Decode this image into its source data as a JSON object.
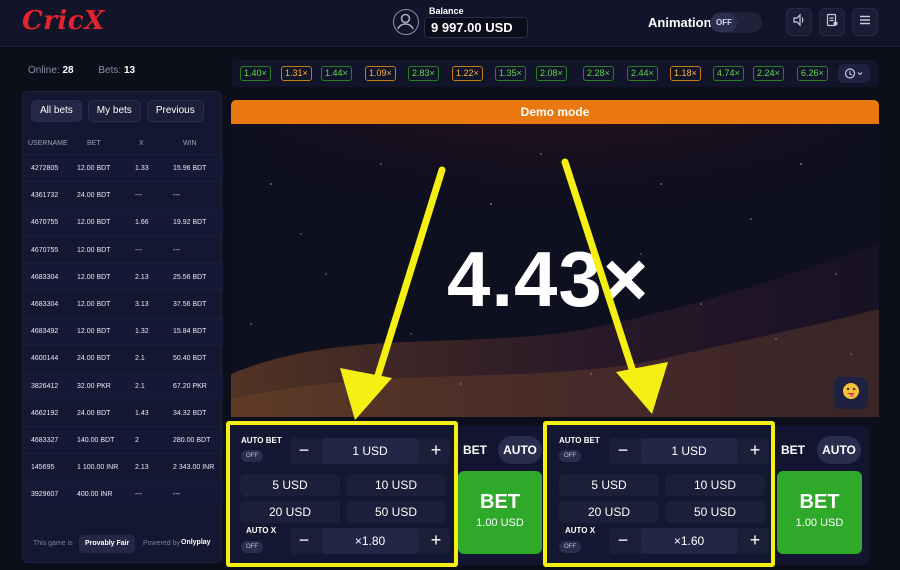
{
  "header": {
    "logo": "CricX",
    "balance_label": "Balance",
    "balance_value": "9 997.00 USD",
    "animation_label": "Animation",
    "animation_toggle": "OFF"
  },
  "sidebar": {
    "online_label": "Online:",
    "online_count": "28",
    "bets_label": "Bets:",
    "bets_count": "13",
    "tabs": [
      {
        "label": "All bets"
      },
      {
        "label": "My bets"
      },
      {
        "label": "Previous"
      }
    ],
    "columns": [
      "USERNAME",
      "BET",
      "X",
      "WIN"
    ],
    "rows": [
      {
        "user": "4272805",
        "bet": "12.00 BDT",
        "x": "1.33",
        "win": "15.96 BDT"
      },
      {
        "user": "4361732",
        "bet": "24.00 BDT",
        "x": "---",
        "win": "---"
      },
      {
        "user": "4670755",
        "bet": "12.00 BDT",
        "x": "1.66",
        "win": "19.92 BDT"
      },
      {
        "user": "4670755",
        "bet": "12.00 BDT",
        "x": "---",
        "win": "---"
      },
      {
        "user": "4683304",
        "bet": "12.00 BDT",
        "x": "2.13",
        "win": "25.56 BDT"
      },
      {
        "user": "4683304",
        "bet": "12.00 BDT",
        "x": "3.13",
        "win": "37.56 BDT"
      },
      {
        "user": "4683492",
        "bet": "12.00 BDT",
        "x": "1.32",
        "win": "15.84 BDT"
      },
      {
        "user": "4600144",
        "bet": "24.00 BDT",
        "x": "2.1",
        "win": "50.40 BDT"
      },
      {
        "user": "3826412",
        "bet": "32.00 PKR",
        "x": "2.1",
        "win": "67.20 PKR"
      },
      {
        "user": "4662192",
        "bet": "24.00 BDT",
        "x": "1.43",
        "win": "34.32 BDT"
      },
      {
        "user": "4683327",
        "bet": "140.00 BDT",
        "x": "2",
        "win": "280.00 BDT"
      },
      {
        "user": "145695",
        "bet": "1 100.00 INR",
        "x": "2.13",
        "win": "2 343.00 INR"
      },
      {
        "user": "3929607",
        "bet": "400.00 INR",
        "x": "---",
        "win": "---"
      }
    ],
    "footer": {
      "prefix": "This game is",
      "badge": "Provably Fair",
      "powered": "Powered by",
      "brand": "Onlyplay"
    }
  },
  "history": [
    {
      "v": "1.40×",
      "c": "green"
    },
    {
      "v": "1.31×",
      "c": "orange"
    },
    {
      "v": "1.44×",
      "c": "green"
    },
    {
      "v": "1.09×",
      "c": "orange"
    },
    {
      "v": "2.83×",
      "c": "green"
    },
    {
      "v": "1.22×",
      "c": "orange"
    },
    {
      "v": "1.35×",
      "c": "green"
    },
    {
      "v": "2.08×",
      "c": "green"
    },
    {
      "v": "2.28×",
      "c": "green"
    },
    {
      "v": "2.44×",
      "c": "green"
    },
    {
      "v": "1.18×",
      "c": "orange"
    },
    {
      "v": "4.74×",
      "c": "green"
    },
    {
      "v": "2.24×",
      "c": "green"
    },
    {
      "v": "6.26×",
      "c": "green"
    }
  ],
  "game": {
    "demo_label": "Demo mode",
    "multiplier": "4.43×"
  },
  "bet_panels": [
    {
      "auto_bet_label": "AUTO BET",
      "auto_bet_toggle": "OFF",
      "amount": "1 USD",
      "quick": [
        "5 USD",
        "10 USD",
        "20 USD",
        "50 USD"
      ],
      "auto_x_label": "AUTO X",
      "auto_x_toggle": "OFF",
      "auto_x_value": "×1.80",
      "mode_bet": "BET",
      "mode_auto": "AUTO",
      "bet_button": "BET",
      "bet_amount": "1.00 USD",
      "minus": "−",
      "plus": "+"
    },
    {
      "auto_bet_label": "AUTO BET",
      "auto_bet_toggle": "OFF",
      "amount": "1 USD",
      "quick": [
        "5 USD",
        "10 USD",
        "20 USD",
        "50 USD"
      ],
      "auto_x_label": "AUTO X",
      "auto_x_toggle": "OFF",
      "auto_x_value": "×1.60",
      "mode_bet": "BET",
      "mode_auto": "AUTO",
      "bet_button": "BET",
      "bet_amount": "1.00 USD",
      "minus": "−",
      "plus": "+"
    }
  ],
  "colors": {
    "green_chip": "#5fd84a",
    "orange_chip": "#ffb43a",
    "demo_bar": "#e8780f",
    "bet_button": "#2ea92a",
    "highlight": "#f5ef14",
    "logo": "#e3232d"
  }
}
